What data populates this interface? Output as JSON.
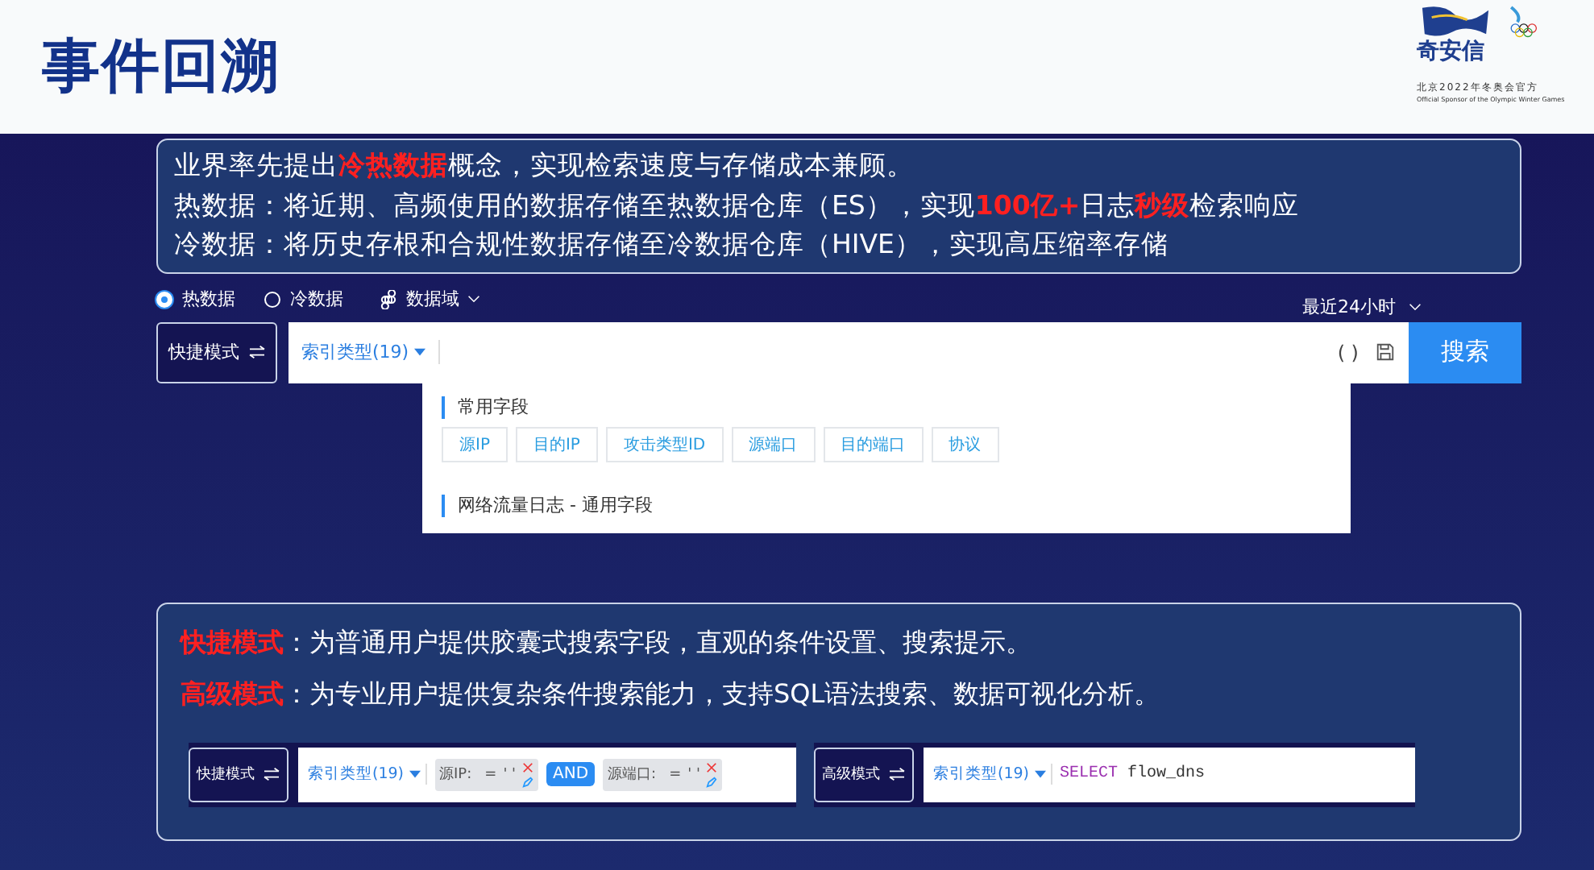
{
  "header": {
    "title": "事件回溯",
    "logo": {
      "brand": "奇安信",
      "sponsor_cn": "北京2022年冬奥会官方",
      "sponsor_en": "Official Sponsor of the Olympic Winter Games"
    }
  },
  "intro": [
    "业界率先提出**冷热数据**概念，实现检索速度与存储成本兼顾。",
    "热数据：将近期、高频使用的数据存储至热数据仓库（ES），实现**100亿+**日志**秒级**检索响应",
    "冷数据：将历史存根和合规性数据存储至冷数据仓库（HIVE），实现高压缩率存储"
  ],
  "data_options": [
    {
      "label": "热数据",
      "selected": true
    },
    {
      "label": "冷数据",
      "selected": false
    }
  ],
  "domain_menu": {
    "label": "数据域"
  },
  "time_range": {
    "label": "最近24小时"
  },
  "search": {
    "mode_button": "快捷模式",
    "index_type": "索引类型(19)",
    "paren": "( )",
    "submit": "搜索"
  },
  "field_panel": {
    "sections": [
      {
        "title": "常用字段",
        "fields": [
          "源IP",
          "目的IP",
          "攻击类型ID",
          "源端口",
          "目的端口",
          "协议"
        ]
      },
      {
        "title": "网络流量日志 - 通用字段"
      }
    ]
  },
  "modes": [
    "**快捷模式**：为普通用户提供胶囊式搜索字段，直观的条件设置、搜索提示。",
    "**高级模式**：为专业用户提供复杂条件搜索能力，支持SQL语法搜索、数据可视化分析。"
  ],
  "examples": [
    {
      "kind": "quick",
      "mode_button": "快捷模式",
      "index_type": "索引类型(19)",
      "conditions": [
        {
          "field": "源IP:",
          "op": "=",
          "value": "' '"
        },
        {
          "connector": "AND",
          "field": "源端口:",
          "op": "=",
          "value": "' '"
        }
      ]
    },
    {
      "kind": "advanced",
      "mode_button": "高级模式",
      "index_type": "索引类型(19)",
      "keyword": "SELECT",
      "query": "flow_dns"
    }
  ]
}
